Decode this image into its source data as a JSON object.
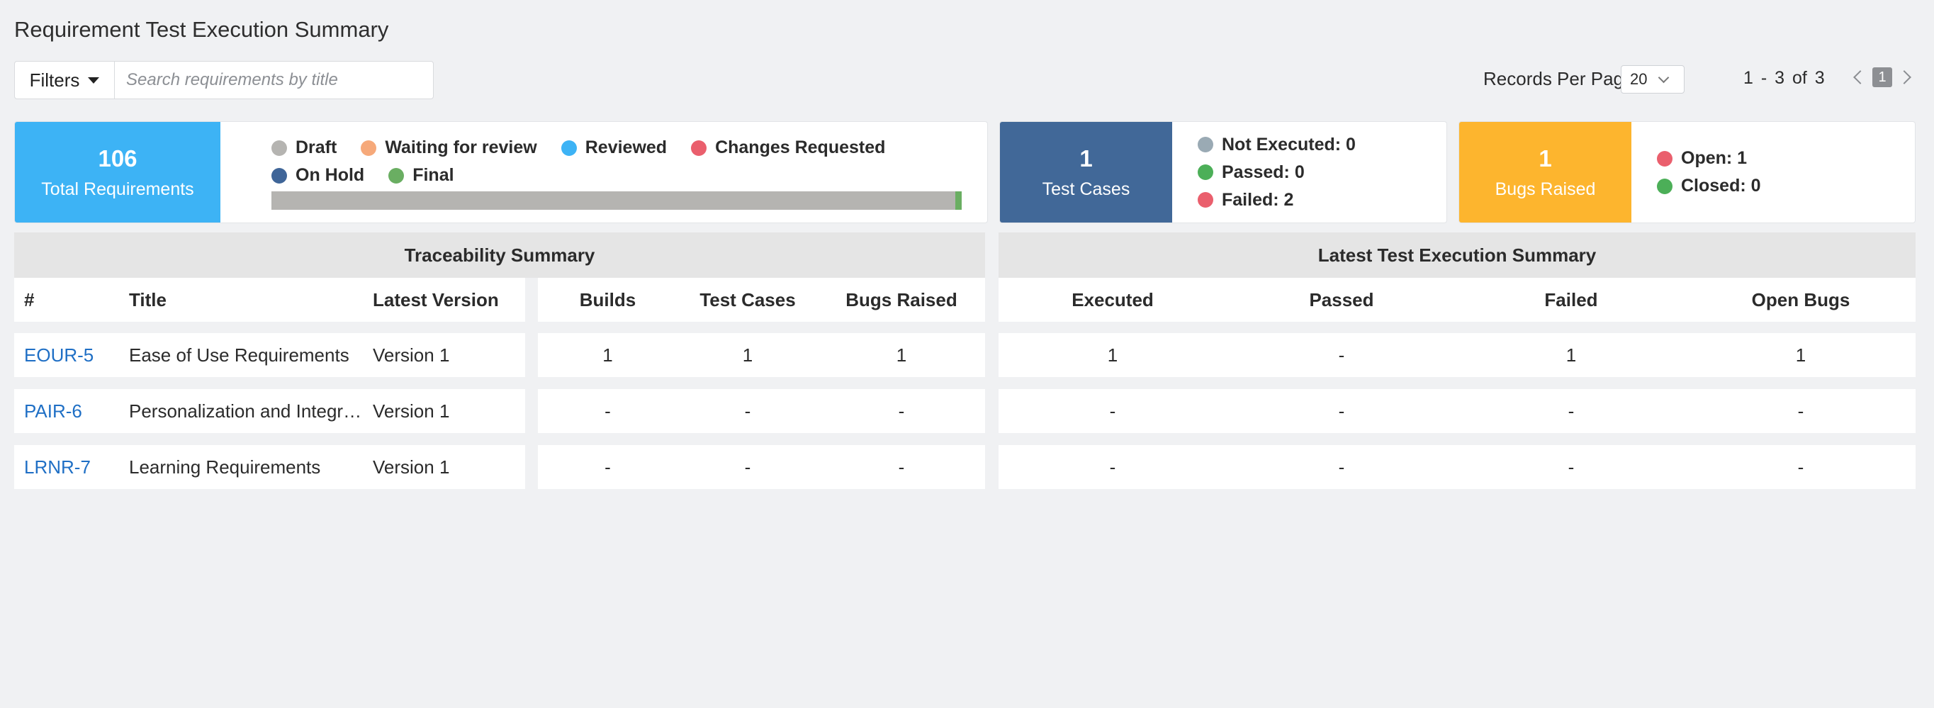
{
  "page": {
    "title": "Requirement Test Execution Summary"
  },
  "toolbar": {
    "filters_label": "Filters",
    "search_placeholder": "Search requirements by title",
    "records_per_page_label": "Records Per Page",
    "records_per_page_value": "20",
    "range_text": "1 - 3  of  3",
    "current_page": "1"
  },
  "requirements_card": {
    "count": "106",
    "label": "Total Requirements",
    "legend": [
      {
        "label": "Draft",
        "color": "#b5b4b1"
      },
      {
        "label": "Waiting for review",
        "color": "#f6a97a"
      },
      {
        "label": "Reviewed",
        "color": "#3db3f5"
      },
      {
        "label": "Changes Requested",
        "color": "#ea5f6d"
      },
      {
        "label": "On Hold",
        "color": "#3f6598"
      },
      {
        "label": "Final",
        "color": "#6aae62"
      }
    ],
    "progress": {
      "final_fraction": 0.009
    }
  },
  "test_cases_card": {
    "count": "1",
    "label": "Test Cases",
    "items": [
      {
        "label": "Not Executed: 0",
        "color": "#9aaab4"
      },
      {
        "label": "Passed: 0",
        "color": "#4caf58"
      },
      {
        "label": "Failed: 2",
        "color": "#ea5f6d"
      }
    ]
  },
  "bugs_card": {
    "count": "1",
    "label": "Bugs Raised",
    "items": [
      {
        "label": "Open: 1",
        "color": "#ea5f6d"
      },
      {
        "label": "Closed: 0",
        "color": "#4caf58"
      }
    ]
  },
  "traceability": {
    "title": "Traceability Summary",
    "columns": [
      "#",
      "Title",
      "Latest Version",
      "Builds",
      "Test Cases",
      "Bugs Raised"
    ]
  },
  "execution": {
    "title": "Latest Test Execution Summary",
    "columns": [
      "Executed",
      "Passed",
      "Failed",
      "Open Bugs"
    ]
  },
  "rows": [
    {
      "id": "EOUR-5",
      "title": "Ease of Use Requirements",
      "version": "Version 1",
      "builds": "1",
      "test_cases": "1",
      "bugs": "1",
      "executed": "1",
      "passed": "-",
      "failed": "1",
      "open_bugs": "1"
    },
    {
      "id": "PAIR-6",
      "title": "Personalization and Integration Requirements",
      "version": "Version 1",
      "builds": "-",
      "test_cases": "-",
      "bugs": "-",
      "executed": "-",
      "passed": "-",
      "failed": "-",
      "open_bugs": "-"
    },
    {
      "id": "LRNR-7",
      "title": "Learning Requirements",
      "version": "Version 1",
      "builds": "-",
      "test_cases": "-",
      "bugs": "-",
      "executed": "-",
      "passed": "-",
      "failed": "-",
      "open_bugs": "-"
    }
  ],
  "colors": {
    "requirements_tile": "#3db3f5",
    "test_cases_tile": "#416898",
    "bugs_tile": "#fdb52e",
    "link": "#1f6fc5"
  }
}
